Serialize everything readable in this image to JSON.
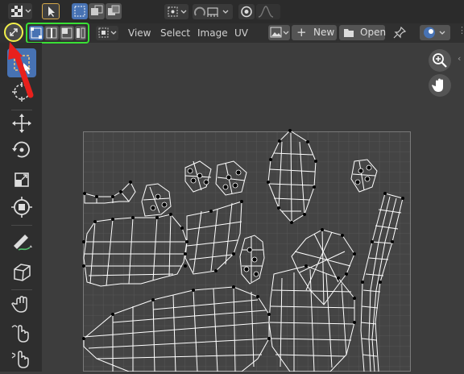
{
  "header": {
    "menus": [
      "View",
      "Select",
      "Image",
      "UV"
    ],
    "new_label": "New",
    "open_label": "Open"
  },
  "colors": {
    "background": "#3d3d3d",
    "header": "#303030",
    "accent_blue": "#4772b3",
    "annotation_yellow": "#f2f04a",
    "annotation_green": "#39e035",
    "annotation_red": "#e8201c",
    "uv_grid": "#5c5c5c",
    "uv_edges": "#ffffff"
  },
  "icons": {
    "sync_selection": "arrows-sync-icon",
    "select_modes": [
      "vertex-select-icon",
      "edge-select-icon",
      "face-select-icon",
      "island-select-icon"
    ],
    "tools": [
      "select-box-icon",
      "cursor-icon",
      "move-icon",
      "rotate-icon",
      "scale-icon",
      "transform-icon",
      "annotate-icon",
      "rip-icon",
      "grab-icon",
      "relax-icon",
      "pinch-icon"
    ]
  }
}
